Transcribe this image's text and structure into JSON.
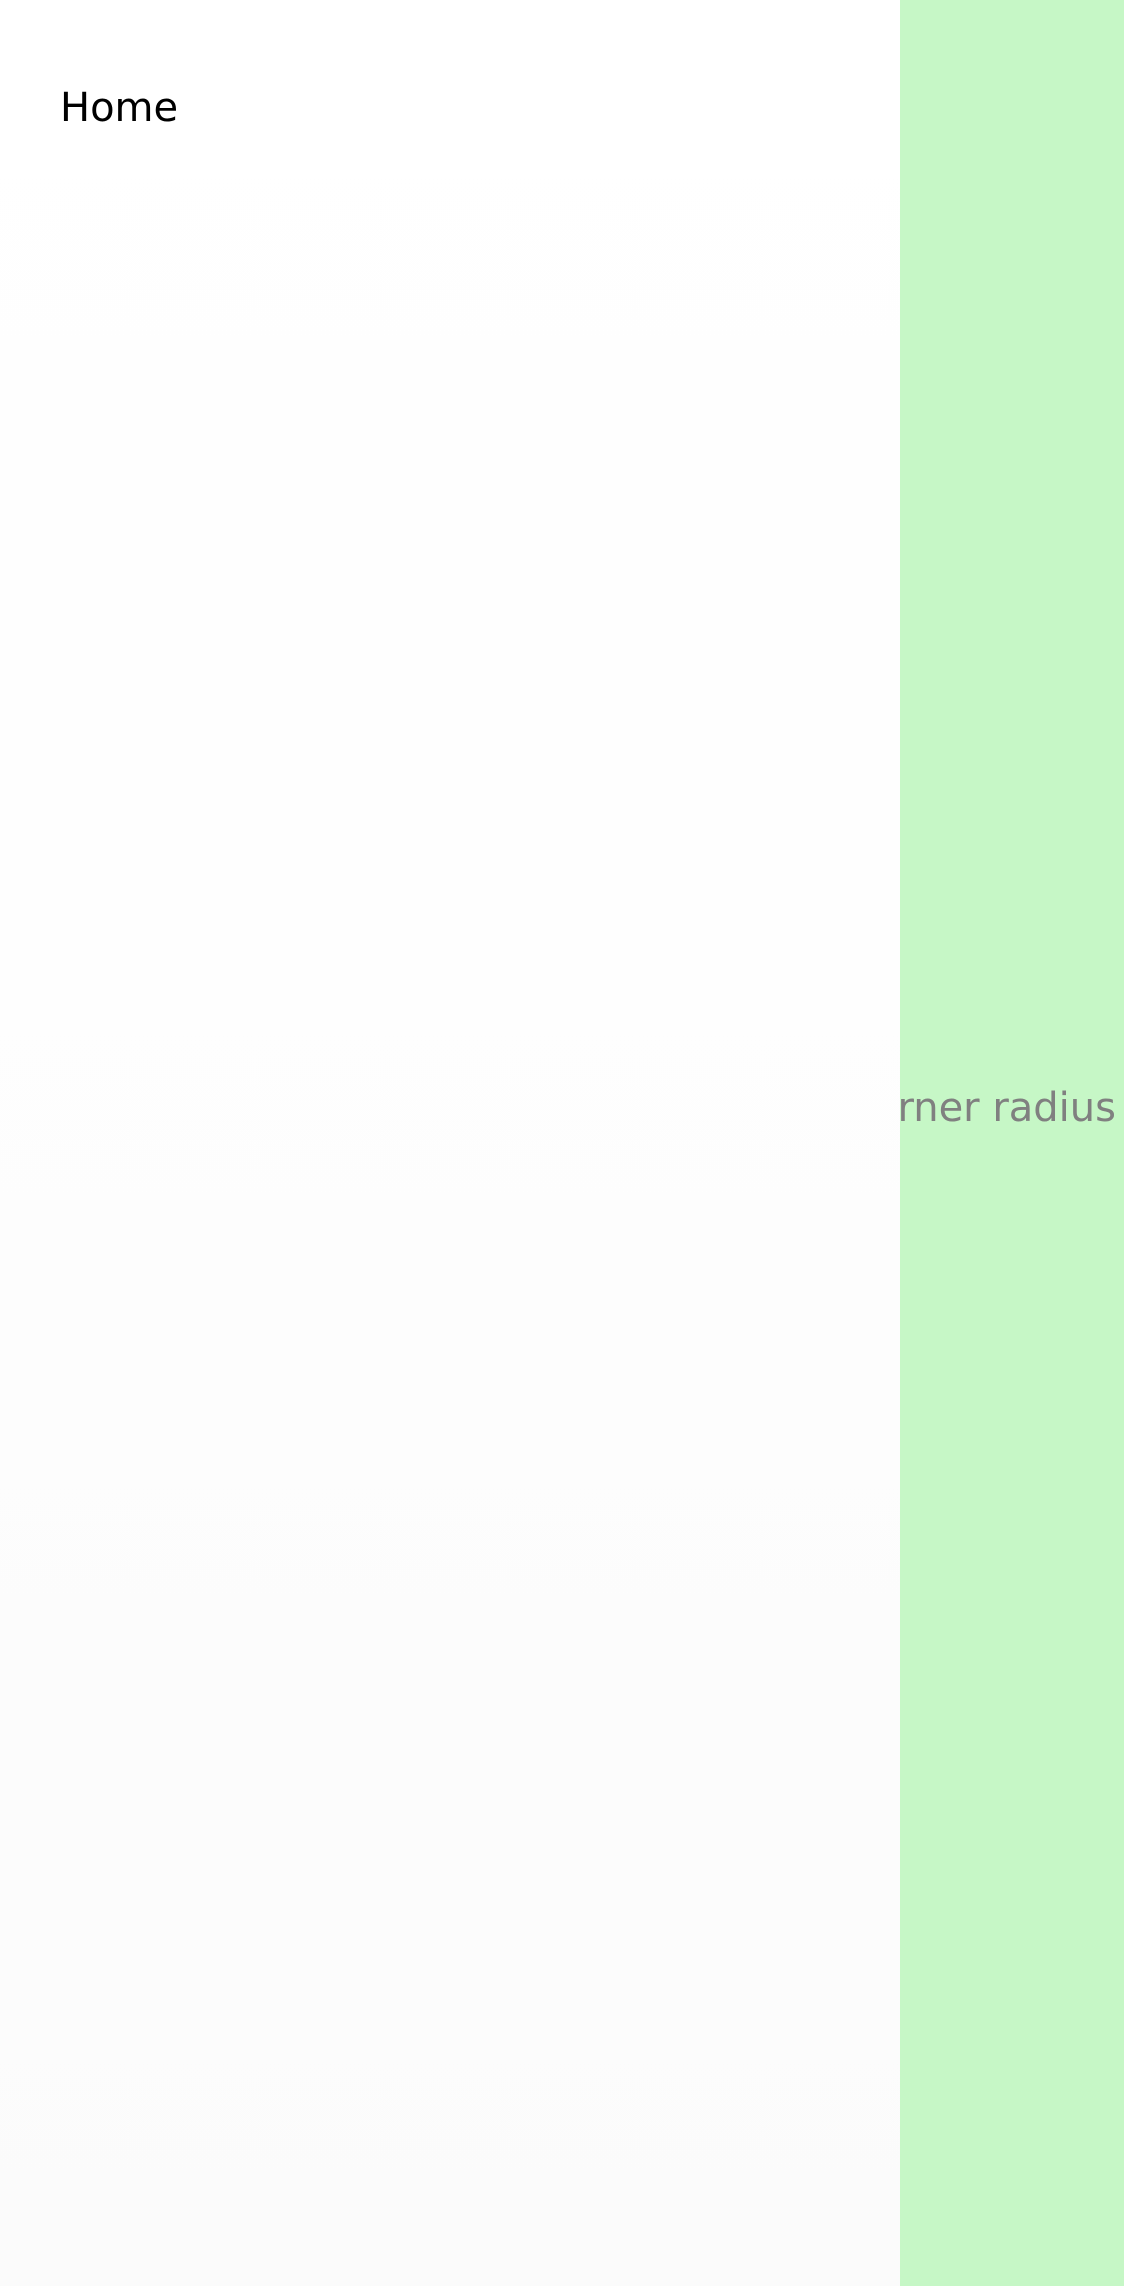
{
  "drawer": {
    "items": [
      {
        "label": "Home"
      }
    ]
  },
  "main": {
    "background_color": "#c6f7c6",
    "visible_text": "orner radius"
  }
}
